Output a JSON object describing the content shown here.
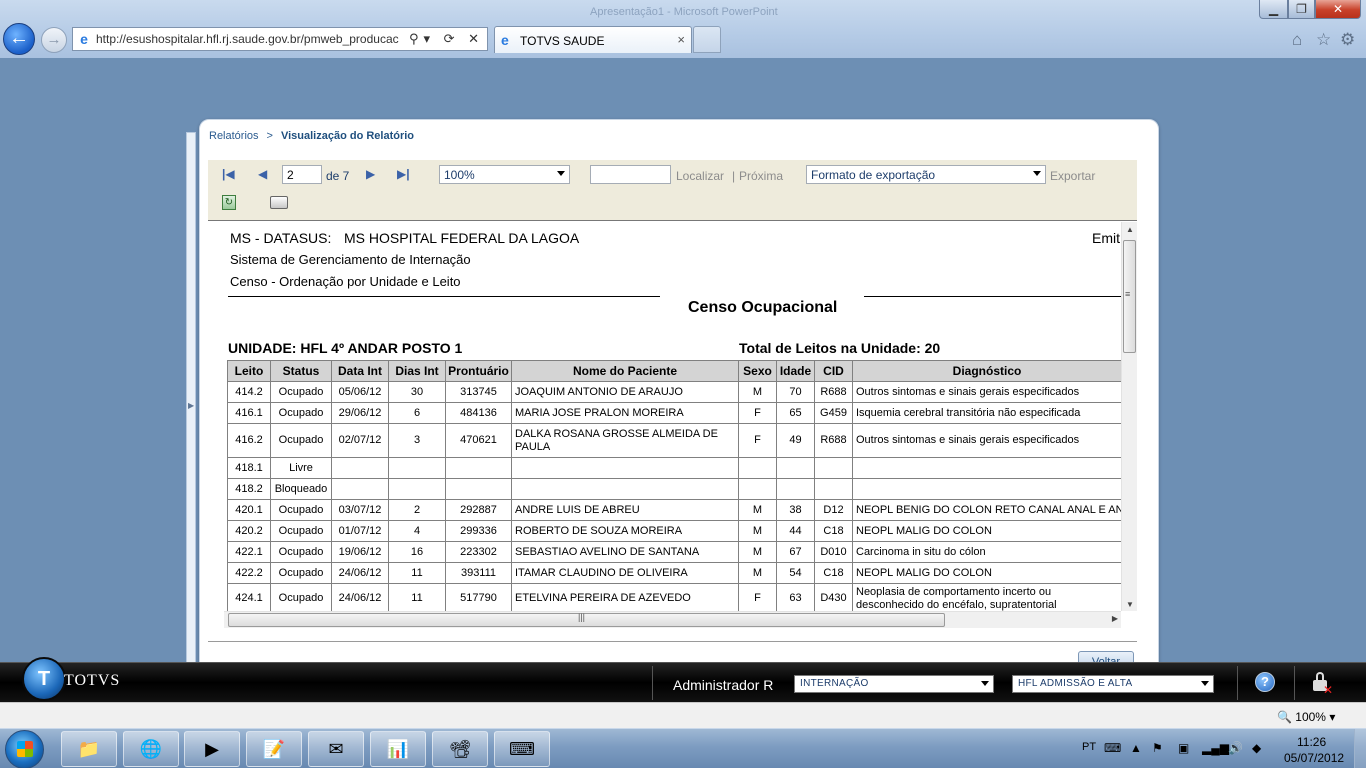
{
  "browser": {
    "window_title_ghost": "Apresentação1 - Microsoft PowerPoint",
    "url": "http://esushospitalar.hfl.rj.saude.gov.br/pmweb_producac",
    "tab_title": "TOTVS SAUDE",
    "tab_close": "×",
    "back_symbol": "←",
    "forward_symbol": "→",
    "address_tools": "⚲▾ ⟳ ✕",
    "home_icon": "⌂",
    "favorites_icon": "☆",
    "tools_icon": "⚙",
    "zoom": "100%"
  },
  "breadcrumb": {
    "root": "Relatórios",
    "separator": ">",
    "current": "Visualização do Relatório"
  },
  "toolbar": {
    "first_icon": "|◀",
    "prev_icon": "◀",
    "next_icon": "▶",
    "last_icon": "▶|",
    "page": "2",
    "page_of": "de 7",
    "zoom_value": "100%",
    "find_label": "Localizar",
    "find_separator": "|",
    "next_label": "Próxima",
    "export_format": "Formato de exportação",
    "export_label": "Exportar"
  },
  "report": {
    "org_label": "MS - DATASUS:",
    "hospital": "MS HOSPITAL FEDERAL DA LAGOA",
    "system": "Sistema de Gerenciamento de Internação",
    "census": "Censo - Ordenação por Unidade e Leito",
    "emit_label": "Emit",
    "title": "Censo Ocupacional",
    "unit": "UNIDADE: HFL 4º ANDAR POSTO 1",
    "total_beds": "Total de Leitos na Unidade: 20",
    "columns": [
      "Leito",
      "Status",
      "Data Int",
      "Dias Int",
      "Prontuário",
      "Nome do Paciente",
      "Sexo",
      "Idade",
      "CID",
      "Diagnóstico"
    ],
    "rows": [
      [
        "414.2",
        "Ocupado",
        "05/06/12",
        "30",
        "313745",
        "JOAQUIM ANTONIO DE ARAUJO",
        "M",
        "70",
        "R688",
        "Outros sintomas e sinais gerais especificados"
      ],
      [
        "416.1",
        "Ocupado",
        "29/06/12",
        "6",
        "484136",
        "MARIA JOSE PRALON MOREIRA",
        "F",
        "65",
        "G459",
        "Isquemia cerebral transitória não especificada"
      ],
      [
        "416.2",
        "Ocupado",
        "02/07/12",
        "3",
        "470621",
        "DALKA ROSANA GROSSE ALMEIDA DE PAULA",
        "F",
        "49",
        "R688",
        "Outros sintomas e sinais gerais especificados"
      ],
      [
        "418.1",
        "Livre",
        "",
        "",
        "",
        "",
        "",
        "",
        "",
        ""
      ],
      [
        "418.2",
        "Bloqueado",
        "",
        "",
        "",
        "",
        "",
        "",
        "",
        ""
      ],
      [
        "420.1",
        "Ocupado",
        "03/07/12",
        "2",
        "292887",
        "ANDRE LUIS DE ABREU",
        "M",
        "38",
        "D12",
        "NEOPL BENIG DO COLON RETO CANAL ANAL E ANUS"
      ],
      [
        "420.2",
        "Ocupado",
        "01/07/12",
        "4",
        "299336",
        "ROBERTO DE SOUZA MOREIRA",
        "M",
        "44",
        "C18",
        "NEOPL MALIG DO COLON"
      ],
      [
        "422.1",
        "Ocupado",
        "19/06/12",
        "16",
        "223302",
        "SEBASTIAO AVELINO DE SANTANA",
        "M",
        "67",
        "D010",
        "Carcinoma in situ do cólon"
      ],
      [
        "422.2",
        "Ocupado",
        "24/06/12",
        "11",
        "393111",
        "ITAMAR CLAUDINO DE OLIVEIRA",
        "M",
        "54",
        "C18",
        "NEOPL MALIG DO COLON"
      ],
      [
        "424.1",
        "Ocupado",
        "24/06/12",
        "11",
        "517790",
        "ETELVINA PEREIRA DE AZEVEDO",
        "F",
        "63",
        "D430",
        "Neoplasia de comportamento incerto ou desconhecido do encéfalo, supratentorial"
      ]
    ],
    "back_button": "Voltar"
  },
  "footer": {
    "brand": "TOTVS",
    "user": "Administrador R",
    "module": "INTERNAÇÃO",
    "unit": "HFL ADMISSÃO E ALTA",
    "help": "?"
  },
  "taskbar": {
    "language": "PT",
    "time": "11:26",
    "date": "05/07/2012"
  }
}
